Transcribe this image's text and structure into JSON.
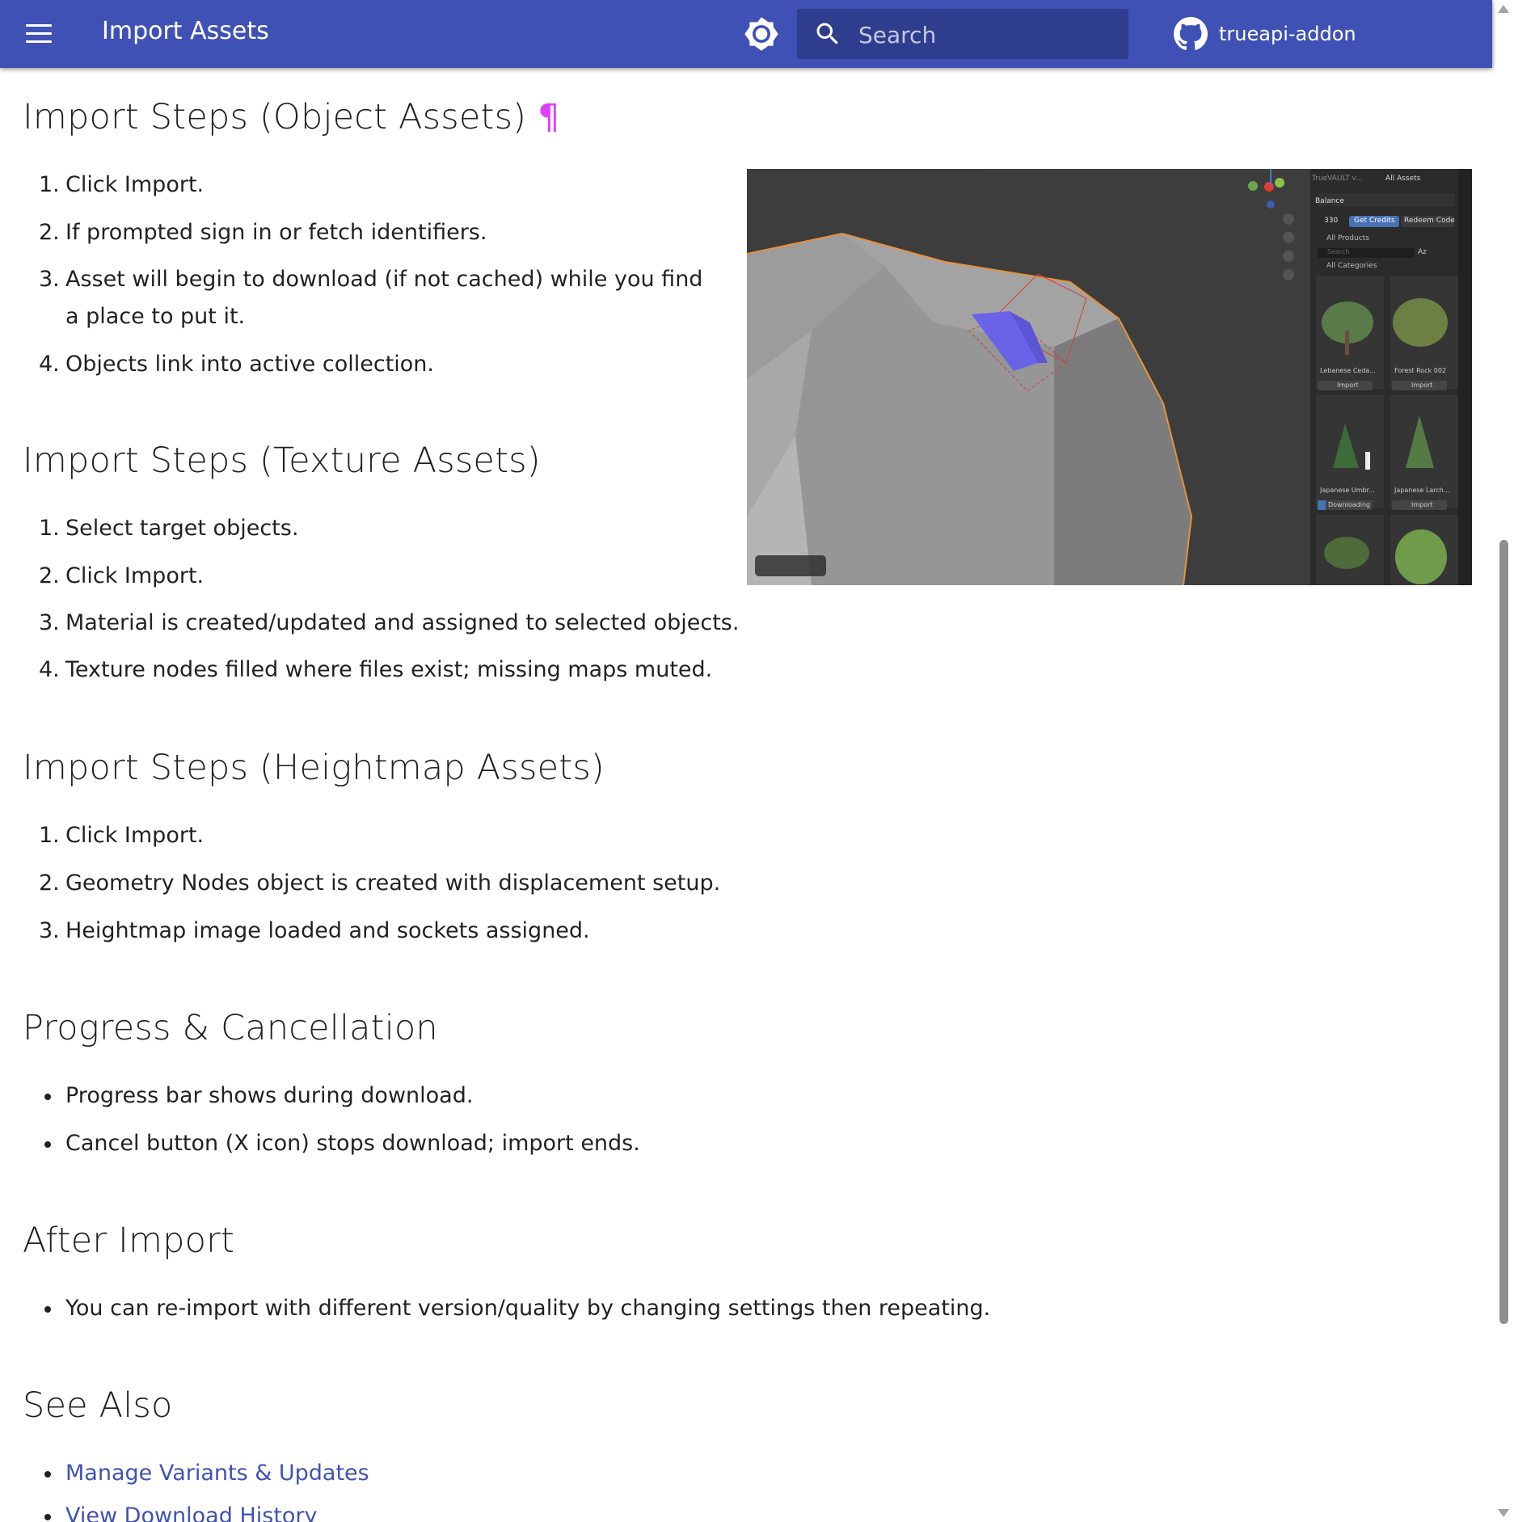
{
  "header": {
    "title": "Import Assets",
    "search_placeholder": "Search",
    "repo_name": "trueapi-addon",
    "color": "#4051b5"
  },
  "sections": {
    "object": {
      "heading": "Import Steps (Object Assets)",
      "permalink": "¶",
      "steps": [
        "Click Import.",
        "If prompted sign in or fetch identifiers.",
        "Asset will begin to download (if not cached) while you find a place to put it.",
        "Objects link into active collection."
      ]
    },
    "texture": {
      "heading": "Import Steps (Texture Assets)",
      "steps": [
        "Select target objects.",
        "Click Import.",
        "Material is created/updated and assigned to selected objects.",
        "Texture nodes filled where files exist; missing maps muted."
      ]
    },
    "heightmap": {
      "heading": "Import Steps (Heightmap Assets)",
      "steps": [
        "Click Import.",
        "Geometry Nodes object is created with displacement setup.",
        "Heightmap image loaded and sockets assigned."
      ]
    },
    "progress": {
      "heading": "Progress & Cancellation",
      "bullets": [
        "Progress bar shows during download.",
        "Cancel button (X icon) stops download; import ends."
      ]
    },
    "after": {
      "heading": "After Import",
      "bullets": [
        "You can re-import with different version/quality by changing settings then repeating."
      ]
    },
    "see_also": {
      "heading": "See Also",
      "links": [
        "Manage Variants & Updates",
        "View Download History"
      ]
    }
  },
  "screenshot": {
    "panel_title": "TrueVAULT v...",
    "scope": "All Assets",
    "balance_label": "Balance",
    "balance_value": "330",
    "get_credits": "Get Credits",
    "redeem_code": "Redeem Code",
    "products": "All Products",
    "search_placeholder": "Search",
    "sort": "Az",
    "categories": "All Categories",
    "assets": [
      {
        "name": "Lebanese Ceda...",
        "action": "Import"
      },
      {
        "name": "Forest Rock 002",
        "action": "Import"
      },
      {
        "name": "Japanese Umbr...",
        "action": "Downloading"
      },
      {
        "name": "Japanese Larch...",
        "action": "Import"
      }
    ]
  }
}
